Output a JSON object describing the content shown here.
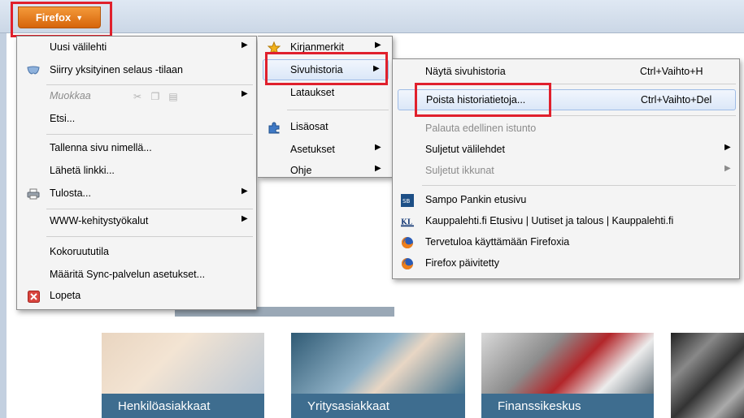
{
  "firefox_button": {
    "label": "Firefox"
  },
  "main_menu": {
    "items": [
      {
        "label": "Uusi välilehti"
      },
      {
        "label": "Siirry yksityinen selaus -tilaan"
      },
      {
        "label": "Muokkaa"
      },
      {
        "label": "Etsi..."
      },
      {
        "label": "Tallenna sivu nimellä..."
      },
      {
        "label": "Lähetä linkki..."
      },
      {
        "label": "Tulosta..."
      },
      {
        "label": "WWW-kehitystyökalut"
      },
      {
        "label": "Kokoruututila"
      },
      {
        "label": "Määritä Sync-palvelun asetukset..."
      },
      {
        "label": "Lopeta"
      }
    ]
  },
  "second_menu": {
    "items": [
      {
        "label": "Kirjanmerkit"
      },
      {
        "label": "Sivuhistoria"
      },
      {
        "label": "Lataukset"
      },
      {
        "label": "Lisäosat"
      },
      {
        "label": "Asetukset"
      },
      {
        "label": "Ohje"
      }
    ]
  },
  "history_menu": {
    "items": [
      {
        "label": "Näytä sivuhistoria",
        "shortcut": "Ctrl+Vaihto+H"
      },
      {
        "label": "Poista historiatietoja...",
        "shortcut": "Ctrl+Vaihto+Del"
      },
      {
        "label": "Palauta edellinen istunto"
      },
      {
        "label": "Suljetut välilehdet"
      },
      {
        "label": "Suljetut ikkunat"
      },
      {
        "label": "Sampo Pankin etusivu"
      },
      {
        "label": "Kauppalehti.fi Etusivu | Uutiset ja talous | Kauppalehti.fi"
      },
      {
        "label": "Tervetuloa käyttämään Firefoxia"
      },
      {
        "label": "Firefox päivitetty"
      }
    ]
  },
  "page_cards": [
    {
      "caption": "Henkilöasiakkaat"
    },
    {
      "caption": "Yritysasiakkaat"
    },
    {
      "caption": "Finanssikeskus"
    }
  ],
  "colors": {
    "highlight": "#e0202c",
    "firefox_orange": "#e97a1f",
    "card_caption": "#3e6d8f"
  },
  "icons": {
    "private": "mask-icon",
    "edit": "edit-icons",
    "print": "printer-icon",
    "quit": "quit-icon",
    "bookmarks": "star-icon",
    "addons": "puzzle-icon",
    "sampo": "sampo-icon",
    "kauppalehti": "kl-icon",
    "firefox": "firefox-icon"
  }
}
